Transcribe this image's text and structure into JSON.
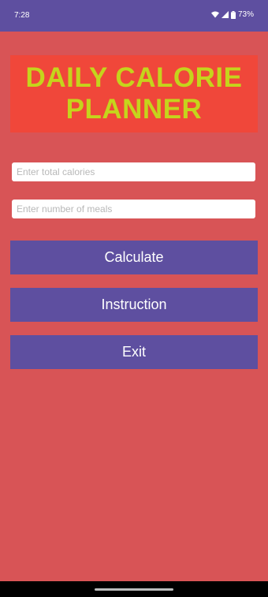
{
  "status_bar": {
    "time": "7:28",
    "battery": "73%",
    "icons": [
      "wifi-icon",
      "signal-icon",
      "battery-icon"
    ]
  },
  "title": {
    "line1": "DAILY CALORIE",
    "line2": "PLANNER"
  },
  "inputs": {
    "calories_placeholder": "Enter total calories",
    "meals_placeholder": "Enter number of meals"
  },
  "buttons": {
    "calculate": "Calculate",
    "instruction": "Instruction",
    "exit": "Exit"
  },
  "colors": {
    "background": "#d85456",
    "title_banner": "#f0473a",
    "title_text": "#c5d41c",
    "button": "#5e4fa0",
    "status_bar": "#5e4fa0"
  }
}
